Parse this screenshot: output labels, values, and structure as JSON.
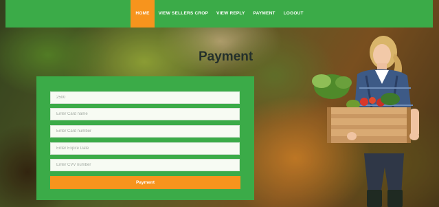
{
  "nav": {
    "items": [
      {
        "label": "HOME",
        "active": true
      },
      {
        "label": "VIEW SELLERS CROP",
        "active": false
      },
      {
        "label": "VIEW REPLY",
        "active": false
      },
      {
        "label": "PAYMENT",
        "active": false
      },
      {
        "label": "LOGOUT",
        "active": false
      }
    ]
  },
  "page": {
    "title": "Payment"
  },
  "form": {
    "amount_value": "2500",
    "card_name_placeholder": "Enter Card name",
    "card_number_placeholder": "Enter Card number",
    "expire_placeholder": "Enter Expire Date",
    "cvv_placeholder": "Enter CVV number",
    "submit_label": "Payment"
  },
  "colors": {
    "brand_green": "#3bab48",
    "accent_orange": "#f7941d"
  }
}
